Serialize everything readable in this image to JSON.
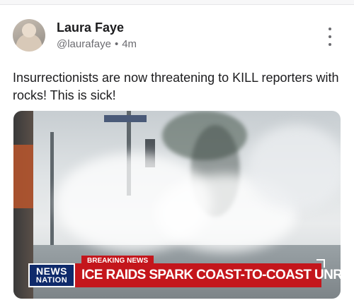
{
  "post": {
    "author_name": "Laura Faye",
    "handle": "@laurafaye",
    "separator": "•",
    "time": "4m",
    "text": "Insurrectionists are now threatening to KILL reporters with rocks! This is sick!"
  },
  "media": {
    "breaking_label": "BREAKING NEWS",
    "logo_line1": "NEWS",
    "logo_line2": "NATION",
    "headline": "ICE RAIDS SPARK COAST-TO-COAST UNREST"
  },
  "icons": {
    "more": "more-vertical-icon",
    "avatar": "profile-photo"
  },
  "colors": {
    "banner_red": "#c4161c",
    "logo_blue": "#0f2a6b",
    "text_primary": "#1c1c1e",
    "text_secondary": "#6b6b70"
  }
}
